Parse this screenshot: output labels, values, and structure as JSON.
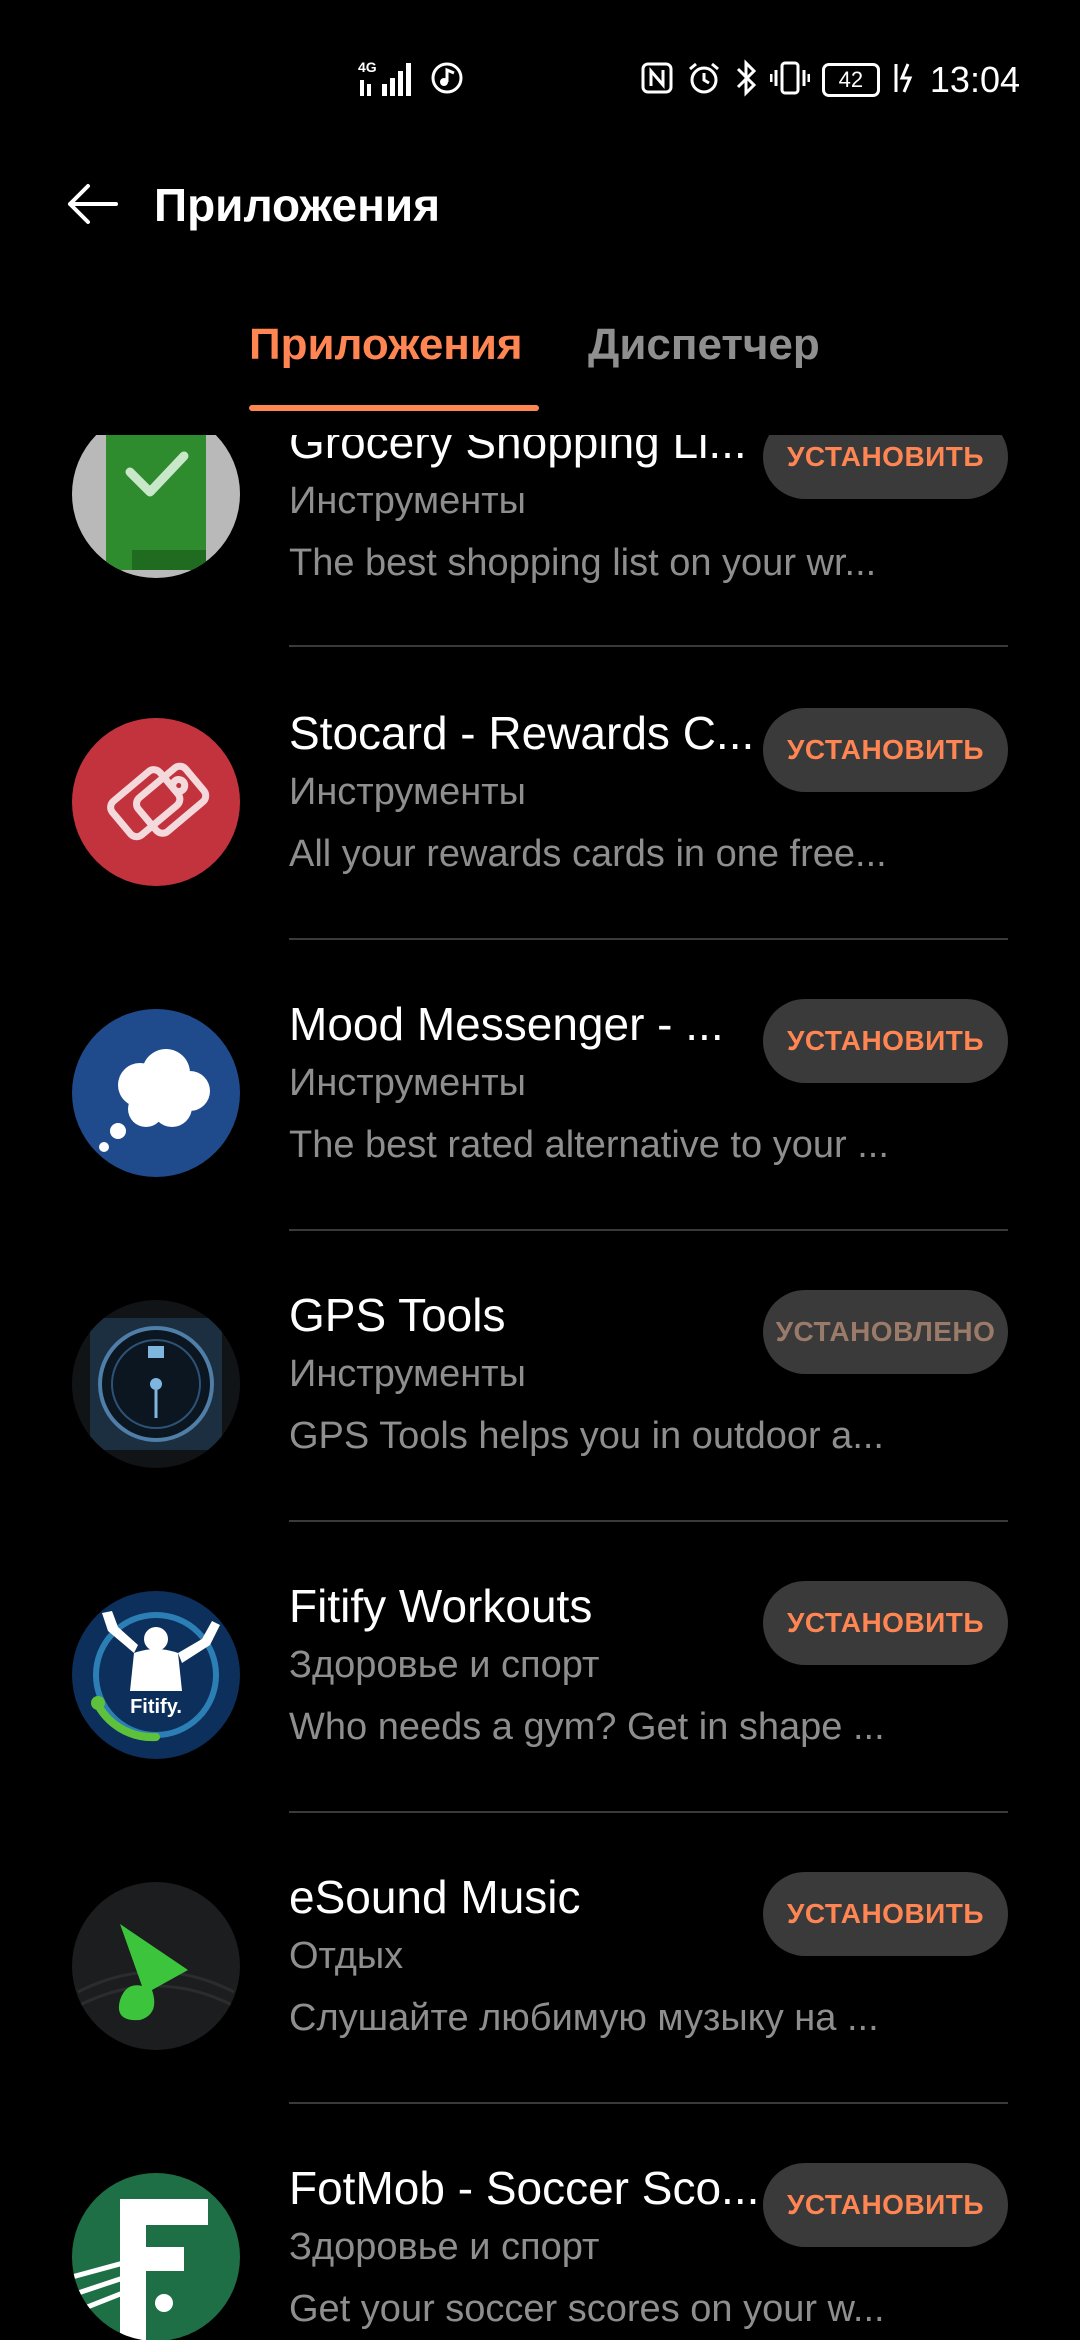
{
  "status_bar": {
    "network": "4G",
    "battery": "42",
    "time": "13:04"
  },
  "header": {
    "title": "Приложения"
  },
  "tabs": [
    {
      "label": "Приложения",
      "active": true
    },
    {
      "label": "Диспетчер",
      "active": false
    }
  ],
  "colors": {
    "accent": "#ff8653",
    "background": "#000000",
    "secondary_text": "#8e8e8e",
    "button_bg": "#3a3a3a"
  },
  "apps": [
    {
      "name": "Grocery Shopping Li...",
      "category": "Инструменты",
      "description": "The best shopping list on your wr...",
      "button": "УСТАНОВИТЬ",
      "icon": "grocery-checkmark-icon"
    },
    {
      "name": "Stocard - Rewards C...",
      "category": "Инструменты",
      "description": "All your rewards cards in one free...",
      "button": "УСТАНОВИТЬ",
      "icon": "stocard-cards-icon"
    },
    {
      "name": "Mood Messenger - ...",
      "category": "Инструменты",
      "description": "The best rated alternative to your ...",
      "button": "УСТАНОВИТЬ",
      "icon": "mood-cloud-icon"
    },
    {
      "name": "GPS Tools",
      "category": "Инструменты",
      "description": "GPS Tools helps you in outdoor a...",
      "button": "УСТАНОВЛЕНО",
      "icon": "gps-watchface-icon"
    },
    {
      "name": "Fitify Workouts",
      "category": "Здоровье и спорт",
      "description": "Who needs a gym? Get in shape ...",
      "button": "УСТАНОВИТЬ",
      "icon": "fitify-athlete-icon",
      "icon_label": "Fitify."
    },
    {
      "name": "eSound Music",
      "category": "Отдых",
      "description": "Слушайте любимую музыку на ...",
      "button": "УСТАНОВИТЬ",
      "icon": "esound-note-icon"
    },
    {
      "name": "FotMob - Soccer Sco...",
      "category": "Здоровье и спорт",
      "description": "Get your soccer scores on your w...",
      "button": "УСТАНОВИТЬ",
      "icon": "fotmob-f-icon"
    }
  ]
}
